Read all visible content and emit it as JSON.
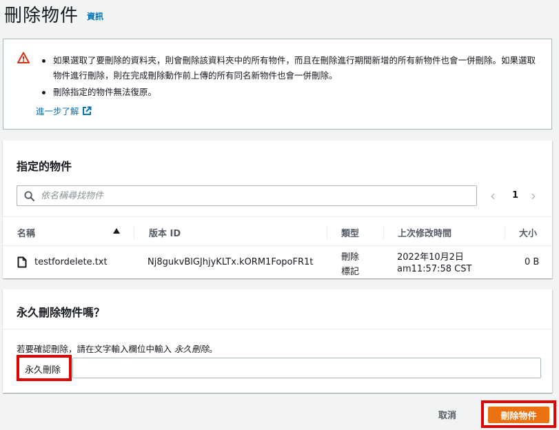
{
  "header": {
    "title": "刪除物件",
    "info_label": "資訊"
  },
  "alert": {
    "icon": "warning-icon",
    "items": [
      "如果選取了要刪除的資料夾，則會刪除該資料夾中的所有物件，而且在刪除進行期間新增的所有新物件也會一併刪除。如果選取物件進行刪除，則在完成刪除動作前上傳的所有同名新物件也會一併刪除。",
      "刪除指定的物件無法復原。"
    ],
    "learn_more": "進一步了解"
  },
  "objects_panel": {
    "title": "指定的物件",
    "search": {
      "placeholder": "依名稱尋找物件",
      "value": ""
    },
    "pager": {
      "current_page": "1"
    },
    "columns": {
      "name": "名稱",
      "version_id": "版本 ID",
      "type": "類型",
      "last_modified": "上次修改時間",
      "size": "大小"
    },
    "rows": [
      {
        "name": "testfordelete.txt",
        "version_id": "Nj8gukvBlGJhjyKLTx.kORM1FopoFR1t",
        "type_line1": "刪除",
        "type_line2": "標記",
        "modified_line1": "2022年10月2日",
        "modified_line2": "am11:57:58 CST",
        "size": "0 B"
      }
    ]
  },
  "confirm_panel": {
    "title": "永久刪除物件嗎？",
    "desc_prefix": "若要確認刪除，請在文字輸入欄位中輸入 ",
    "desc_keyword": "永久刪除",
    "desc_suffix": "。",
    "input_value": "永久刪除"
  },
  "footer": {
    "cancel_label": "取消",
    "delete_label": "刪除物件"
  },
  "colors": {
    "primary_button": "#ec7211",
    "highlight": "#e00000",
    "link": "#0073bb",
    "warning": "#d13212"
  }
}
